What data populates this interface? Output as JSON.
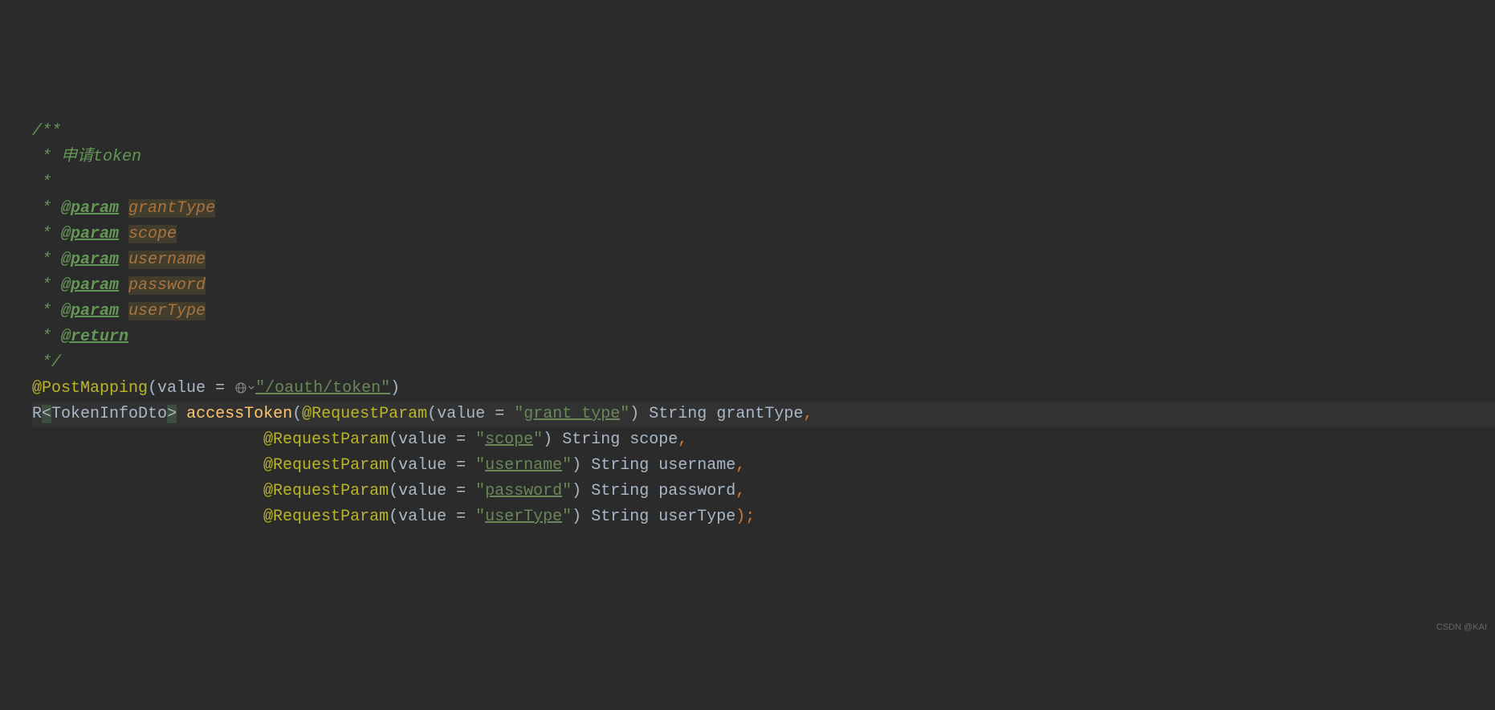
{
  "javadoc": {
    "open": "/**",
    "desc_prefix": " * ",
    "desc": "申请token",
    "blank": " *",
    "param_tag": "@param",
    "params": [
      "grantType",
      "scope",
      "username",
      "password",
      "userType"
    ],
    "return_tag": "@return",
    "close": " */"
  },
  "annotation": {
    "name": "@PostMapping",
    "attr": "value",
    "eq": " = ",
    "url": "\"/oauth/token\""
  },
  "method": {
    "return_type": "R",
    "generic_open": "<",
    "generic_type": "TokenInfoDto",
    "generic_close": ">",
    "name": "accessToken",
    "param_anno": "@RequestParam",
    "param_attr": "value",
    "eq": " = ",
    "java_type": "String",
    "params": [
      {
        "value": "grant_type",
        "name": "grantType",
        "end": ","
      },
      {
        "value": "scope",
        "name": "scope",
        "end": ","
      },
      {
        "value": "username",
        "name": "username",
        "end": ","
      },
      {
        "value": "password",
        "name": "password",
        "end": ","
      },
      {
        "value": "userType",
        "name": "userType",
        "end": ");"
      }
    ]
  },
  "watermark": "CSDN @KAI"
}
